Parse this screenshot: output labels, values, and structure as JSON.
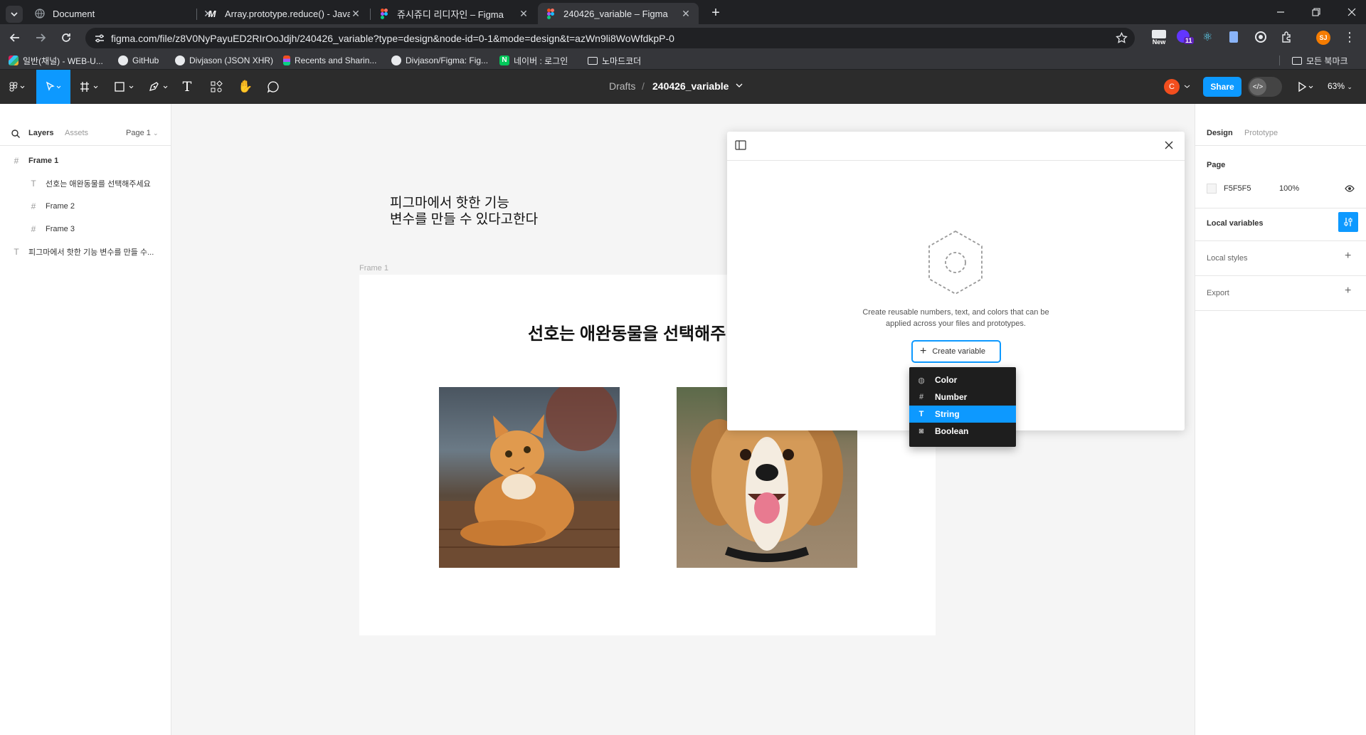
{
  "browser": {
    "tabs": [
      {
        "title": "Document",
        "favicon": "globe-icon"
      },
      {
        "title": "Array.prototype.reduce() - JavaScript",
        "favicon": "mdn-icon"
      },
      {
        "title": "쥬시쥬디 리디자인 – Figma",
        "favicon": "figma-icon"
      },
      {
        "title": "240426_variable – Figma",
        "favicon": "figma-icon"
      }
    ],
    "url": "figma.com/file/z8V0NyPayuED2RIrOoJdjh/240426_variable?type=design&node-id=0-1&mode=design&t=azWn9li8WoWfdkpP-0",
    "extension_badge": "11",
    "new_badge": "New",
    "profile_initials": "SJ",
    "bookmarks": [
      {
        "label": "일반(채널) - WEB-U...",
        "icon": "slack-icon"
      },
      {
        "label": "GitHub",
        "icon": "github-icon"
      },
      {
        "label": "Divjason (JSON XHR)",
        "icon": "github-icon"
      },
      {
        "label": "Recents and Sharin...",
        "icon": "figma-icon"
      },
      {
        "label": "Divjason/Figma: Fig...",
        "icon": "github-icon"
      },
      {
        "label": "네이버 : 로그인",
        "icon": "naver-icon"
      },
      {
        "label": "노마드코더",
        "icon": "folder-icon"
      }
    ],
    "all_bookmarks": "모든 북마크"
  },
  "figma": {
    "breadcrumb_root": "Drafts",
    "breadcrumb_sep": "/",
    "file_name": "240426_variable",
    "user_avatar": "C",
    "share_label": "Share",
    "zoom": "63%",
    "left_tabs": {
      "layers": "Layers",
      "assets": "Assets",
      "page": "Page 1"
    },
    "layers": [
      {
        "name": "Frame 1",
        "icon": "#",
        "depth": 0,
        "bold": true
      },
      {
        "name": "선호는 애완동물를 선택해주세요",
        "icon": "T",
        "depth": 1
      },
      {
        "name": "Frame 2",
        "icon": "#",
        "depth": 1
      },
      {
        "name": "Frame 3",
        "icon": "#",
        "depth": 1
      },
      {
        "name": "피그마에서 핫한 기능 변수를 만들 수...",
        "icon": "T",
        "depth": 0
      }
    ],
    "right_tabs": {
      "design": "Design",
      "prototype": "Prototype"
    },
    "page_section": {
      "title": "Page",
      "color": "F5F5F5",
      "opacity": "100%"
    },
    "local_variables": "Local variables",
    "local_styles": "Local styles",
    "export": "Export",
    "canvas": {
      "heading_line1": "피그마에서 핫한 기능",
      "heading_line2": "변수를 만들 수 있다고한다",
      "frame_label": "Frame 1",
      "frame_title": "선호는 애완동물을 선택해주"
    },
    "variables_modal": {
      "description_line1": "Create reusable numbers, text, and colors that can be",
      "description_line2": "applied across your files and prototypes.",
      "create_label": "Create variable",
      "types": [
        {
          "label": "Color",
          "icon": "color-icon"
        },
        {
          "label": "Number",
          "icon": "number-icon"
        },
        {
          "label": "String",
          "icon": "string-icon",
          "selected": true
        },
        {
          "label": "Boolean",
          "icon": "boolean-icon"
        }
      ]
    },
    "help": "?"
  }
}
